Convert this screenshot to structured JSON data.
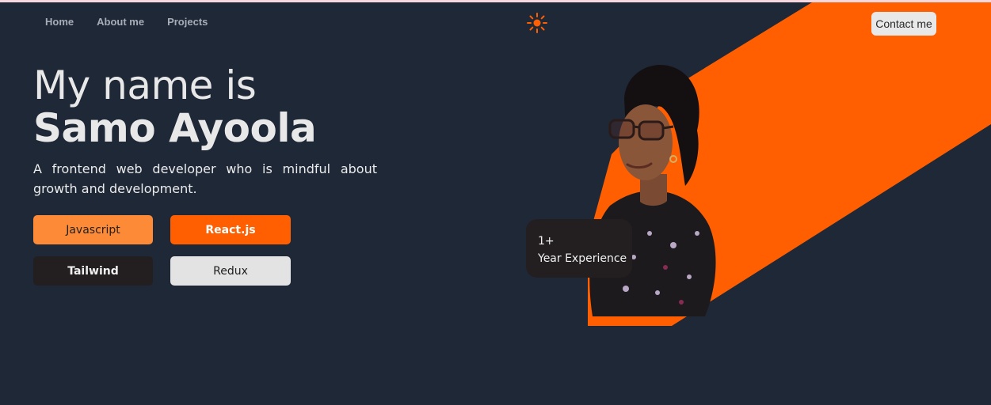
{
  "nav": {
    "links": [
      "Home",
      "About me",
      "Projects"
    ],
    "theme_icon": "sun-icon",
    "contact_label": "Contact me"
  },
  "hero": {
    "intro": "My name is",
    "name": "Samo Ayoola",
    "description": "A frontend web developer who is mindful about growth and development."
  },
  "skills": [
    "Javascript",
    "React.js",
    "Tailwind",
    "Redux"
  ],
  "experience": {
    "count": "1+",
    "label": "Year Experience"
  },
  "colors": {
    "background": "#1f2837",
    "accent": "#ff5f01",
    "accent_light": "#fc8a37",
    "dark": "#231f20",
    "light": "#e3e3e3"
  }
}
